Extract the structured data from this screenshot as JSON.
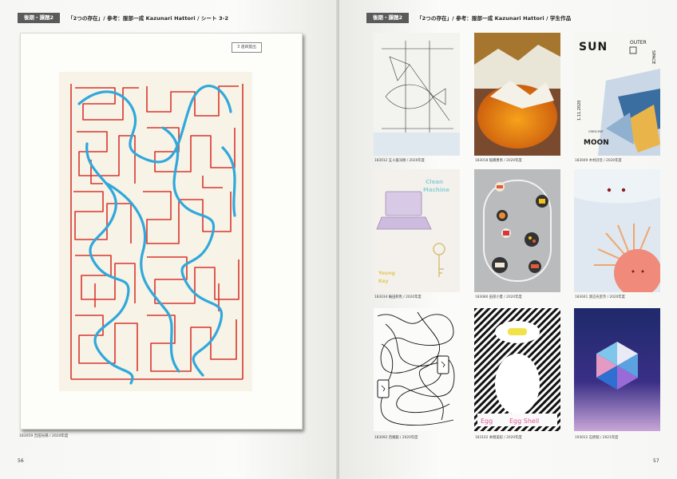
{
  "left_page": {
    "tag": "後期・課題2",
    "title": "「2つの存在」/ 参考：服部一成 Kazunari Hattori / シート 3-2",
    "stamp": "3 週目提出",
    "caption": "183059 吉田光陽 / 2020年度",
    "page_number": "56"
  },
  "right_page": {
    "tag": "後期・課題2",
    "title": "「2つの存在」/ 参考：服部一成 Kazunari Hattori / 学生作品",
    "page_number": "57",
    "works": [
      {
        "caption": "183012 五十嵐洋樹 / 2020年度"
      },
      {
        "caption": "183018 稲橋勇男 / 2020年度"
      },
      {
        "caption": "183049 木村詩音 / 2020年度",
        "text": {
          "sun": "SUN",
          "outer": "OUTER",
          "space": "SPACE",
          "moon": "MOON",
          "date": "1.11.2020",
          "extra": "CRESCENT"
        }
      },
      {
        "caption": "183034 輪田和馬 / 2020年度",
        "text": {
          "line1": "Clean",
          "line2": "Machine",
          "line3": "Young",
          "line4": "Key"
        }
      },
      {
        "caption": "183080 田部小夏 / 2020年度"
      },
      {
        "caption": "183041 渡辺光里奈 / 2020年度"
      },
      {
        "caption": "183092 西尾聡 / 2020年度"
      },
      {
        "caption": "183102 本間美紀 / 2020年度",
        "text": {
          "egg": "Egg",
          "shell": "Egg Shell"
        }
      },
      {
        "caption": "193012 石原梨 / 2021年度"
      }
    ]
  },
  "colors": {
    "tag_bg": "#5a5a5a",
    "red_line": "#d8362e",
    "blue_line": "#2fa8dc",
    "bg_cream": "#f7f3e6"
  }
}
